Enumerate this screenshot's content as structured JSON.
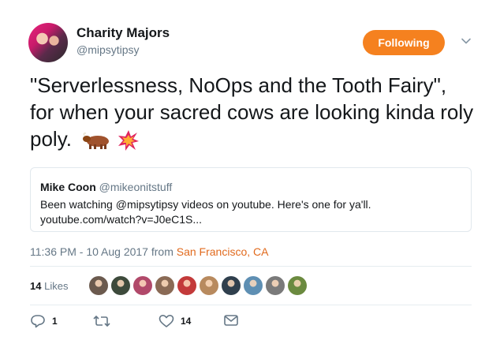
{
  "author": {
    "display_name": "Charity Majors",
    "handle": "@mipsytipsy",
    "avatar_icon": "profile-photo"
  },
  "follow_button": {
    "label": "Following",
    "color": "#f5811f"
  },
  "tweet": {
    "text": "\"Serverlessness, NoOps and the Tooth Fairy\", for when your sacred cows are looking kinda roly poly.",
    "emojis": [
      "ox-emoji",
      "collision-emoji"
    ]
  },
  "quoted_tweet": {
    "name": "Mike Coon",
    "handle": "@mikeonitstuff",
    "text": "Been watching @mipsytipsy videos on youtube. Here's one for ya'll. youtube.com/watch?v=J0eC1S..."
  },
  "meta": {
    "time": "11:36 PM - 10 Aug 2017 from",
    "location": "San Francisco, CA",
    "location_color": "#e16a1d"
  },
  "likes": {
    "count": "14",
    "label": "Likes",
    "liker_colors": [
      "#6b5a4e",
      "#3d4a3b",
      "#b1496a",
      "#8a6a55",
      "#c33a3a",
      "#b88a5e",
      "#2f3f4d",
      "#5e8fb3",
      "#7a7a7a",
      "#6b8a3f"
    ]
  },
  "actions": {
    "reply_count": "1",
    "retweet_count": "",
    "like_count": "14"
  }
}
